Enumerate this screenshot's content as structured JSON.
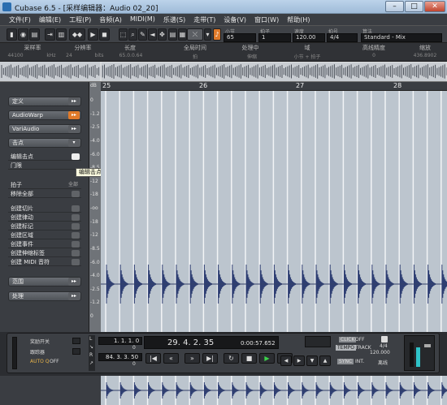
{
  "window": {
    "title": "Cubase 6.5 - [采样编辑器：Audio 02_20]"
  },
  "menu": [
    "文件(F)",
    "编辑(E)",
    "工程(P)",
    "音频(A)",
    "MIDI(M)",
    "乐谱(S)",
    "走带(T)",
    "设备(V)",
    "窗口(W)",
    "帮助(H)"
  ],
  "toolbar": {
    "bar_label": "小节",
    "bar_value": "65",
    "beat_label": "拍子",
    "beat_value": "1",
    "tempo_label": "速度",
    "tempo_value": "120.00",
    "sig_label": "拍号",
    "sig_value": "4/4",
    "algo_label": "算法",
    "algo_value": "Standard - Mix"
  },
  "info": {
    "headers": [
      "采样率",
      "分辨率",
      "长度",
      "全局时间",
      "处理中",
      "域",
      "高线精度",
      "缩放"
    ],
    "values": [
      "44100",
      "kHz",
      "24",
      "bits",
      "65.0.0.64",
      "拍",
      "伸缩",
      "小节 + 拍子",
      "0",
      "436.8902"
    ]
  },
  "ruler": {
    "bars": [
      "25",
      "26",
      "27",
      "28"
    ]
  },
  "db": {
    "unit": "dB",
    "ticks": [
      "0",
      "-1.2",
      "-2.5",
      "-4.0",
      "-6.0",
      "-8.5",
      "-12",
      "-18",
      "-oo",
      "-18",
      "-12",
      "-8.5",
      "-6.0",
      "-4.0",
      "-2.5",
      "-1.2",
      "0"
    ]
  },
  "left": {
    "sections": [
      "定义",
      "AudioWarp",
      "VariAudio",
      "击点",
      "范围",
      "处理"
    ],
    "hit_items": [
      "编辑击点",
      "门限"
    ],
    "beat_label": "拍子",
    "beat_value": "全部",
    "remove_all": "移除全部",
    "create_items": [
      "创建切片",
      "创建律动",
      "创建标记",
      "创建区域",
      "创建事件",
      "创建伸缩标签",
      "创建 MIDI 音符"
    ],
    "tooltip": "编辑击点"
  },
  "transport": {
    "quantize_label": "奖励开关",
    "punch_label": "跟踪器",
    "autoq_label": "AUTO Q",
    "autoq_value": "OFF",
    "left_locator": "1. 1. 1. 0",
    "right_locator": "84. 3. 3. 50",
    "position": "29. 4. 2. 35",
    "time": "0:00:57.652",
    "click_label": "CLICK",
    "click_value": "OFF",
    "tempo_label": "TEMPO",
    "tempo_value": "TRACK",
    "sig_value": "4/4",
    "bpm_value": "120.000",
    "sync_label": "SYNC",
    "sync_value": "INT.",
    "offline_label": "离线",
    "val0": "0",
    "val1": "0"
  }
}
